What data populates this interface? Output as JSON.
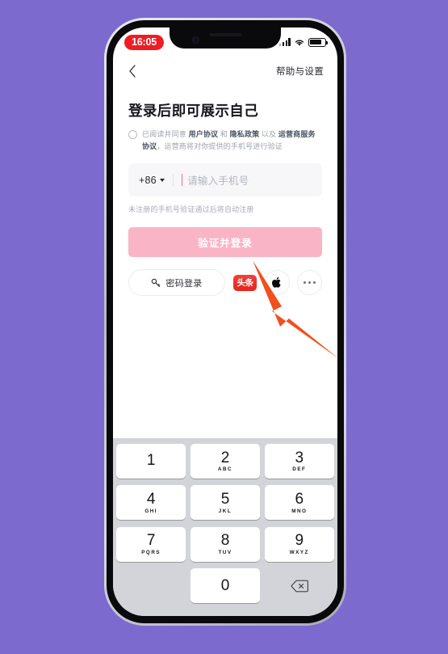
{
  "status_bar": {
    "time": "16:05",
    "icons": [
      "signal-icon",
      "wifi-icon",
      "battery-icon"
    ],
    "time_pill_color": "#ee1d24"
  },
  "nav": {
    "back_icon": "chevron-left-icon",
    "help_label": "帮助与设置"
  },
  "login": {
    "title": "登录后即可展示自己",
    "agreement": {
      "prefix": "已阅读并同意",
      "link1": "用户协议",
      "conj1": "和",
      "link2": "隐私政策",
      "conj2": "以及",
      "link3": "运营商服务协议",
      "suffix": "，运营商将对你提供的手机号进行验证",
      "checked": false
    },
    "country_code": "+86",
    "phone_value": "",
    "phone_placeholder": "请输入手机号",
    "hint": "未注册的手机号验证通过后将自动注册",
    "submit_label": "验证并登录",
    "submit_color": "#f9b5c6",
    "password_label": "密码登录",
    "social": [
      {
        "name": "toutiao",
        "label": "头条"
      },
      {
        "name": "apple",
        "label": ""
      },
      {
        "name": "more",
        "label": ""
      }
    ]
  },
  "keyboard": {
    "rows": [
      [
        {
          "num": "1",
          "sub": ""
        },
        {
          "num": "2",
          "sub": "ABC"
        },
        {
          "num": "3",
          "sub": "DEF"
        }
      ],
      [
        {
          "num": "4",
          "sub": "GHI"
        },
        {
          "num": "5",
          "sub": "JKL"
        },
        {
          "num": "6",
          "sub": "MNO"
        }
      ],
      [
        {
          "num": "7",
          "sub": "PQRS"
        },
        {
          "num": "8",
          "sub": "TUV"
        },
        {
          "num": "9",
          "sub": "WXYZ"
        }
      ],
      [
        {
          "num": "",
          "sub": "",
          "type": "blank"
        },
        {
          "num": "0",
          "sub": ""
        },
        {
          "num": "",
          "sub": "",
          "type": "delete"
        }
      ]
    ]
  },
  "annotation": {
    "arrow_color": "#f1501e",
    "points_to": "toutiao-login-icon"
  },
  "background_color": "#7d6ace"
}
